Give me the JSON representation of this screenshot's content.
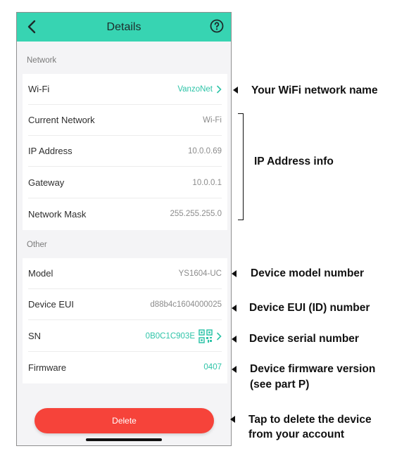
{
  "header": {
    "title": "Details",
    "back_icon": "chevron-left-icon",
    "help_icon": "question-circle-icon"
  },
  "sections": {
    "network_label": "Network",
    "other_label": "Other"
  },
  "network_rows": [
    {
      "label": "Wi-Fi",
      "value": "VanzoNet"
    },
    {
      "label": "Current Network",
      "value": "Wi-Fi"
    },
    {
      "label": "IP Address",
      "value": "10.0.0.69"
    },
    {
      "label": "Gateway",
      "value": "10.0.0.1"
    },
    {
      "label": "Network Mask",
      "value": "255.255.255.0"
    }
  ],
  "other_rows": [
    {
      "label": "Model",
      "value": "YS1604-UC"
    },
    {
      "label": "Device EUI",
      "value": "d88b4c1604000025"
    },
    {
      "label": "SN",
      "value": "0B0C1C903E"
    },
    {
      "label": "Firmware",
      "value": "0407"
    }
  ],
  "delete_label": "Delete",
  "annotations": {
    "wifi": "Your WiFi network name",
    "ip": "IP Address info",
    "model": "Device model number",
    "eui": "Device EUI (ID) number",
    "sn": "Device serial number",
    "firmware_line1": "Device firmware version",
    "firmware_line2": "(see part P)",
    "delete_line1": "Tap to delete the device",
    "delete_line2": "from your account"
  },
  "colors": {
    "header": "#37d4b2",
    "accent": "#2ec4a8",
    "delete": "#f6433a"
  }
}
